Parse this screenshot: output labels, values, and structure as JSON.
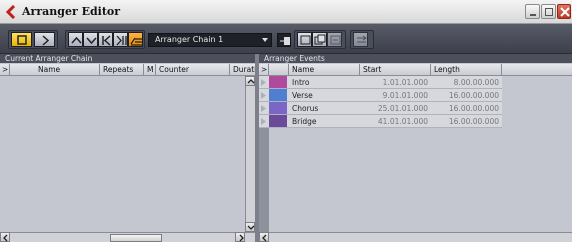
{
  "window": {
    "title": "Arranger Editor"
  },
  "toolbar": {
    "chain_selected": "Arranger Chain 1"
  },
  "left_panel": {
    "title": "Current Arranger Chain",
    "columns": {
      "expand": ">",
      "name": "Name",
      "repeats": "Repeats",
      "mode": "M",
      "counter": "Counter",
      "duration": "Duratio"
    }
  },
  "right_panel": {
    "title": "Arranger Events",
    "columns": {
      "expand": ">",
      "name": "Name",
      "start": "Start",
      "length": "Length"
    },
    "rows": [
      {
        "name": "Intro",
        "start": "1.01.01.000",
        "length": "8.00.00.000",
        "color": "#b04a9c"
      },
      {
        "name": "Verse",
        "start": "9.01.01.000",
        "length": "16.00.00.000",
        "color": "#4f7fd0"
      },
      {
        "name": "Chorus",
        "start": "25.01.01.000",
        "length": "16.00.00.000",
        "color": "#7a66c4"
      },
      {
        "name": "Bridge",
        "start": "41.01.01.000",
        "length": "16.00.00.000",
        "color": "#6b4a9a"
      }
    ]
  },
  "colors": {
    "toolbar": "#4a4e5a",
    "active_button": "#f3c21b",
    "close_button": "#c94a33"
  }
}
